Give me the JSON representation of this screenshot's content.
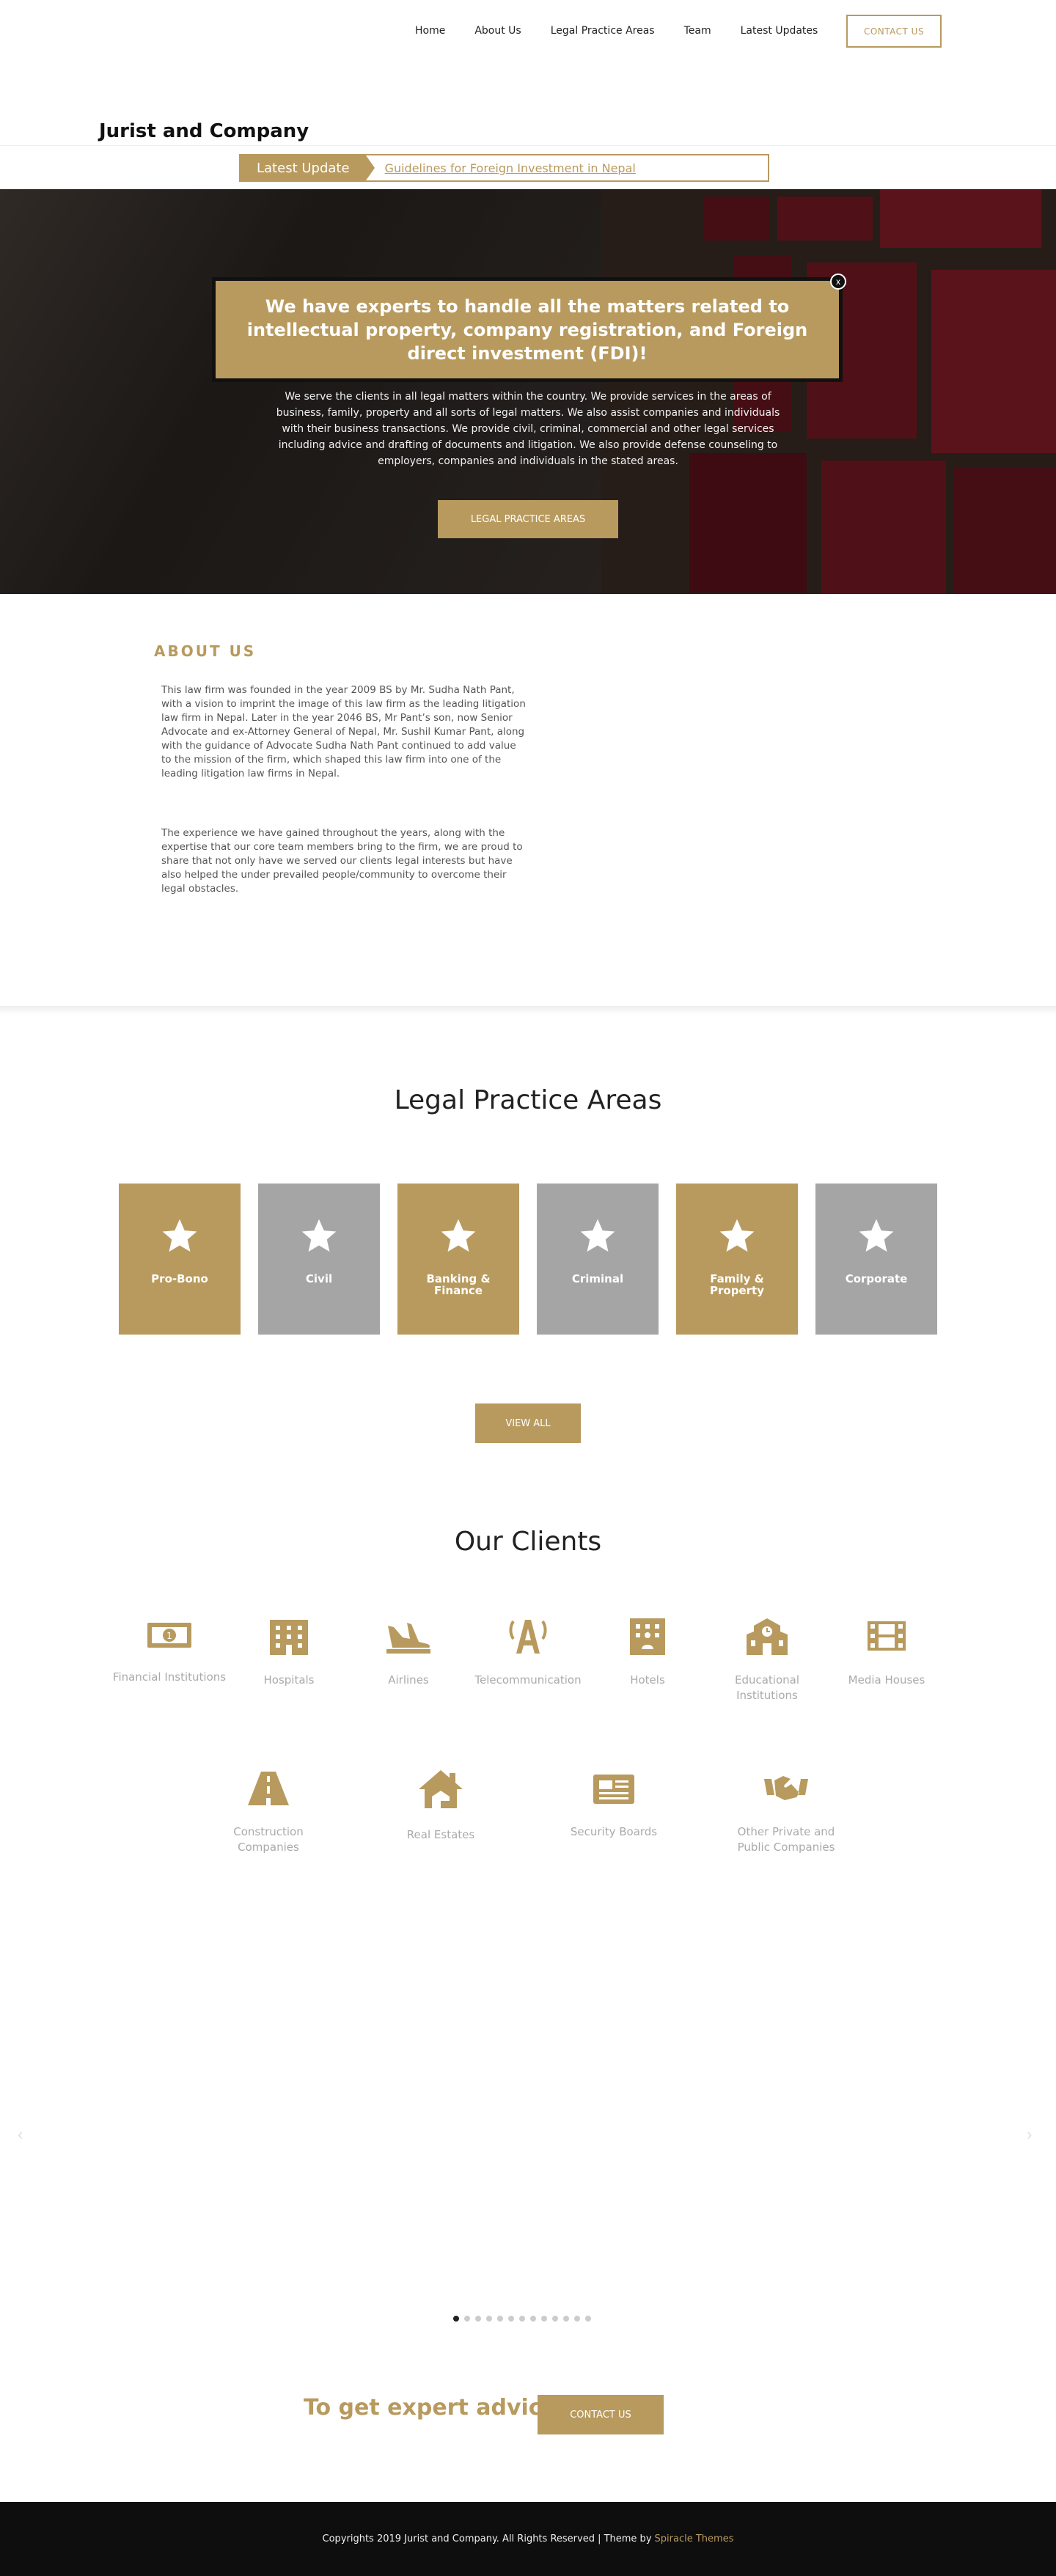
{
  "nav": {
    "items": [
      "Home",
      "About Us",
      "Legal Practice Areas",
      "Team",
      "Latest Updates"
    ],
    "contact": "CONTACT US"
  },
  "brand": "Jurist and Company",
  "ticker": {
    "label": "Latest Update",
    "link": "Guidelines for Foreign Investment in Nepal"
  },
  "hero": {
    "popup": "We have experts to handle all the matters related to intellectual property, company registration, and Foreign direct investment (FDI)!",
    "close": "x",
    "text": "We serve the clients in all legal matters within the country. We provide services in the areas of business, family, property and all sorts of legal matters. We also assist companies and individuals with their business transactions. We provide civil, criminal, commercial and other legal services including advice and drafting of documents and litigation. We also provide defense counseling to employers, companies and individuals in the stated areas.",
    "button": "LEGAL PRACTICE AREAS"
  },
  "about": {
    "title": "ABOUT US",
    "p1": "This law firm was founded in the year 2009 BS by Mr. Sudha Nath Pant, with a vision to imprint the image of this law firm as the leading litigation law firm in Nepal. Later in the year 2046 BS, Mr Pant’s son, now Senior Advocate and ex-Attorney General of Nepal, Mr. Sushil Kumar Pant, along with the guidance of Advocate Sudha Nath Pant continued to add value to the mission of the firm, which shaped this law firm into one of the leading litigation law firms in Nepal.",
    "p2": "The experience we have gained throughout the years, along with the expertise that our core team members bring to the firm, we are proud to share that not only have we served our clients legal interests but have also helped the under prevailed people/community to overcome their legal obstacles."
  },
  "practice": {
    "title": "Legal Practice Areas",
    "cards": [
      "Pro-Bono",
      "Civil",
      "Banking & Finance",
      "Criminal",
      "Family & Property",
      "Corporate"
    ],
    "view_all": "VIEW ALL"
  },
  "clients": {
    "title": "Our Clients",
    "row1": [
      {
        "label": "Financial Institutions",
        "icon": "money-icon"
      },
      {
        "label": "Hospitals",
        "icon": "building-icon"
      },
      {
        "label": "Airlines",
        "icon": "plane-landing-icon"
      },
      {
        "label": "Telecommunication",
        "icon": "antenna-icon"
      },
      {
        "label": "Hotels",
        "icon": "hotel-icon"
      },
      {
        "label": "Educational Institutions",
        "icon": "school-icon"
      },
      {
        "label": "Media Houses",
        "icon": "film-icon"
      }
    ],
    "row2": [
      {
        "label": "Construction Companies",
        "icon": "road-icon"
      },
      {
        "label": "Real Estates",
        "icon": "house-icon"
      },
      {
        "label": "Security Boards",
        "icon": "newspaper-icon"
      },
      {
        "label": "Other Private and Public Companies",
        "icon": "handshake-icon"
      }
    ]
  },
  "carousel": {
    "prev": "‹",
    "next": "›",
    "dots": 13,
    "active": 0
  },
  "cta": {
    "text": "To get expert advice",
    "button": "CONTACT US"
  },
  "footer": {
    "text": "Copyrights 2019 Jurist and Company. All Rights Reserved | Theme by",
    "link": "Spiracle Themes"
  },
  "colors": {
    "accent": "#b89a5e",
    "grey": "#a5a5a5",
    "footer": "#0e0e0e"
  }
}
